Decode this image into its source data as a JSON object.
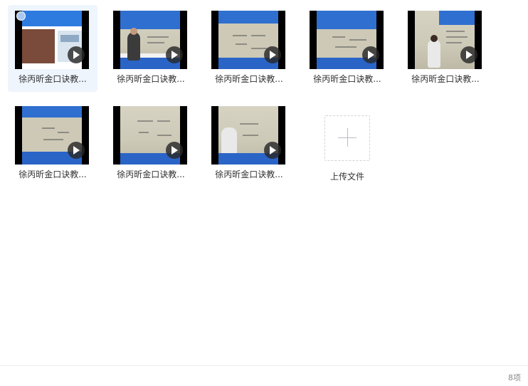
{
  "files": [
    {
      "name": "徐丙昕金口诀教...",
      "selected": true
    },
    {
      "name": "徐丙昕金口诀教..."
    },
    {
      "name": "徐丙昕金口诀教..."
    },
    {
      "name": "徐丙昕金口诀教..."
    },
    {
      "name": "徐丙昕金口诀教..."
    },
    {
      "name": "徐丙昕金口诀教..."
    },
    {
      "name": "徐丙昕金口诀教..."
    },
    {
      "name": "徐丙昕金口诀教..."
    }
  ],
  "upload": {
    "label": "上传文件"
  },
  "status": {
    "item_count": "8项"
  },
  "colors": {
    "selected_bg": "#eef5fd",
    "play_bg": "#282828",
    "video_band": "#2f6fd0"
  },
  "icons": {
    "play": "play-icon",
    "plus": "plus-icon"
  }
}
